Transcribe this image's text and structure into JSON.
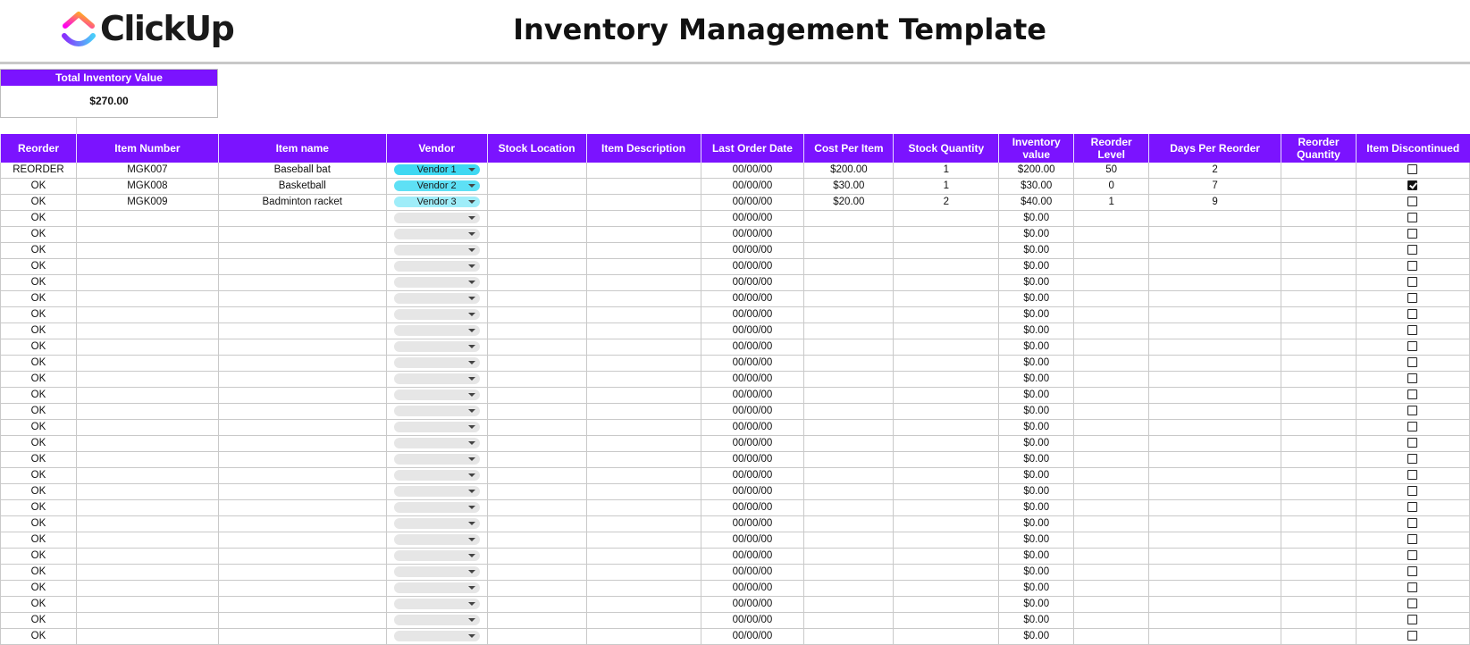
{
  "brand": {
    "name": "ClickUp",
    "logo_icon": "clickup-logo-icon"
  },
  "title": "Inventory Management Template",
  "summary": {
    "label": "Total Inventory Value",
    "value": "$270.00"
  },
  "columns": [
    "Reorder",
    "Item Number",
    "Item name",
    "Vendor",
    "Stock Location",
    "Item Description",
    "Last Order Date",
    "Cost Per Item",
    "Stock Quantity",
    "Inventory value",
    "Reorder Level",
    "Days Per Reorder",
    "Reorder Quantity",
    "Item Discontinued"
  ],
  "vendor_colors": {
    "Vendor 1": "#3fd8f2",
    "Vendor 2": "#5ee0f5",
    "Vendor 3": "#9fedf9"
  },
  "accent_color": "#7b13ff",
  "rows": [
    {
      "reorder": "REORDER",
      "item_number": "MGK007",
      "item_name": "Baseball bat",
      "vendor": "Vendor 1",
      "stock_location": "",
      "item_description": "",
      "last_order_date": "00/00/00",
      "cost_per_item": "$200.00",
      "stock_quantity": "1",
      "inventory_value": "$200.00",
      "reorder_level": "50",
      "days_per_reorder": "2",
      "reorder_quantity": "",
      "discontinued": false
    },
    {
      "reorder": "OK",
      "item_number": "MGK008",
      "item_name": "Basketball",
      "vendor": "Vendor 2",
      "stock_location": "",
      "item_description": "",
      "last_order_date": "00/00/00",
      "cost_per_item": "$30.00",
      "stock_quantity": "1",
      "inventory_value": "$30.00",
      "reorder_level": "0",
      "days_per_reorder": "7",
      "reorder_quantity": "",
      "discontinued": true
    },
    {
      "reorder": "OK",
      "item_number": "MGK009",
      "item_name": "Badminton racket",
      "vendor": "Vendor 3",
      "stock_location": "",
      "item_description": "",
      "last_order_date": "00/00/00",
      "cost_per_item": "$20.00",
      "stock_quantity": "2",
      "inventory_value": "$40.00",
      "reorder_level": "1",
      "days_per_reorder": "9",
      "reorder_quantity": "",
      "discontinued": false
    },
    {
      "reorder": "OK",
      "item_number": "",
      "item_name": "",
      "vendor": "",
      "stock_location": "",
      "item_description": "",
      "last_order_date": "00/00/00",
      "cost_per_item": "",
      "stock_quantity": "",
      "inventory_value": "$0.00",
      "reorder_level": "",
      "days_per_reorder": "",
      "reorder_quantity": "",
      "discontinued": false
    },
    {
      "reorder": "OK",
      "item_number": "",
      "item_name": "",
      "vendor": "",
      "stock_location": "",
      "item_description": "",
      "last_order_date": "00/00/00",
      "cost_per_item": "",
      "stock_quantity": "",
      "inventory_value": "$0.00",
      "reorder_level": "",
      "days_per_reorder": "",
      "reorder_quantity": "",
      "discontinued": false
    },
    {
      "reorder": "OK",
      "item_number": "",
      "item_name": "",
      "vendor": "",
      "stock_location": "",
      "item_description": "",
      "last_order_date": "00/00/00",
      "cost_per_item": "",
      "stock_quantity": "",
      "inventory_value": "$0.00",
      "reorder_level": "",
      "days_per_reorder": "",
      "reorder_quantity": "",
      "discontinued": false
    },
    {
      "reorder": "OK",
      "item_number": "",
      "item_name": "",
      "vendor": "",
      "stock_location": "",
      "item_description": "",
      "last_order_date": "00/00/00",
      "cost_per_item": "",
      "stock_quantity": "",
      "inventory_value": "$0.00",
      "reorder_level": "",
      "days_per_reorder": "",
      "reorder_quantity": "",
      "discontinued": false
    },
    {
      "reorder": "OK",
      "item_number": "",
      "item_name": "",
      "vendor": "",
      "stock_location": "",
      "item_description": "",
      "last_order_date": "00/00/00",
      "cost_per_item": "",
      "stock_quantity": "",
      "inventory_value": "$0.00",
      "reorder_level": "",
      "days_per_reorder": "",
      "reorder_quantity": "",
      "discontinued": false
    },
    {
      "reorder": "OK",
      "item_number": "",
      "item_name": "",
      "vendor": "",
      "stock_location": "",
      "item_description": "",
      "last_order_date": "00/00/00",
      "cost_per_item": "",
      "stock_quantity": "",
      "inventory_value": "$0.00",
      "reorder_level": "",
      "days_per_reorder": "",
      "reorder_quantity": "",
      "discontinued": false
    },
    {
      "reorder": "OK",
      "item_number": "",
      "item_name": "",
      "vendor": "",
      "stock_location": "",
      "item_description": "",
      "last_order_date": "00/00/00",
      "cost_per_item": "",
      "stock_quantity": "",
      "inventory_value": "$0.00",
      "reorder_level": "",
      "days_per_reorder": "",
      "reorder_quantity": "",
      "discontinued": false
    },
    {
      "reorder": "OK",
      "item_number": "",
      "item_name": "",
      "vendor": "",
      "stock_location": "",
      "item_description": "",
      "last_order_date": "00/00/00",
      "cost_per_item": "",
      "stock_quantity": "",
      "inventory_value": "$0.00",
      "reorder_level": "",
      "days_per_reorder": "",
      "reorder_quantity": "",
      "discontinued": false
    },
    {
      "reorder": "OK",
      "item_number": "",
      "item_name": "",
      "vendor": "",
      "stock_location": "",
      "item_description": "",
      "last_order_date": "00/00/00",
      "cost_per_item": "",
      "stock_quantity": "",
      "inventory_value": "$0.00",
      "reorder_level": "",
      "days_per_reorder": "",
      "reorder_quantity": "",
      "discontinued": false
    },
    {
      "reorder": "OK",
      "item_number": "",
      "item_name": "",
      "vendor": "",
      "stock_location": "",
      "item_description": "",
      "last_order_date": "00/00/00",
      "cost_per_item": "",
      "stock_quantity": "",
      "inventory_value": "$0.00",
      "reorder_level": "",
      "days_per_reorder": "",
      "reorder_quantity": "",
      "discontinued": false
    },
    {
      "reorder": "OK",
      "item_number": "",
      "item_name": "",
      "vendor": "",
      "stock_location": "",
      "item_description": "",
      "last_order_date": "00/00/00",
      "cost_per_item": "",
      "stock_quantity": "",
      "inventory_value": "$0.00",
      "reorder_level": "",
      "days_per_reorder": "",
      "reorder_quantity": "",
      "discontinued": false
    },
    {
      "reorder": "OK",
      "item_number": "",
      "item_name": "",
      "vendor": "",
      "stock_location": "",
      "item_description": "",
      "last_order_date": "00/00/00",
      "cost_per_item": "",
      "stock_quantity": "",
      "inventory_value": "$0.00",
      "reorder_level": "",
      "days_per_reorder": "",
      "reorder_quantity": "",
      "discontinued": false
    },
    {
      "reorder": "OK",
      "item_number": "",
      "item_name": "",
      "vendor": "",
      "stock_location": "",
      "item_description": "",
      "last_order_date": "00/00/00",
      "cost_per_item": "",
      "stock_quantity": "",
      "inventory_value": "$0.00",
      "reorder_level": "",
      "days_per_reorder": "",
      "reorder_quantity": "",
      "discontinued": false
    },
    {
      "reorder": "OK",
      "item_number": "",
      "item_name": "",
      "vendor": "",
      "stock_location": "",
      "item_description": "",
      "last_order_date": "00/00/00",
      "cost_per_item": "",
      "stock_quantity": "",
      "inventory_value": "$0.00",
      "reorder_level": "",
      "days_per_reorder": "",
      "reorder_quantity": "",
      "discontinued": false
    },
    {
      "reorder": "OK",
      "item_number": "",
      "item_name": "",
      "vendor": "",
      "stock_location": "",
      "item_description": "",
      "last_order_date": "00/00/00",
      "cost_per_item": "",
      "stock_quantity": "",
      "inventory_value": "$0.00",
      "reorder_level": "",
      "days_per_reorder": "",
      "reorder_quantity": "",
      "discontinued": false
    },
    {
      "reorder": "OK",
      "item_number": "",
      "item_name": "",
      "vendor": "",
      "stock_location": "",
      "item_description": "",
      "last_order_date": "00/00/00",
      "cost_per_item": "",
      "stock_quantity": "",
      "inventory_value": "$0.00",
      "reorder_level": "",
      "days_per_reorder": "",
      "reorder_quantity": "",
      "discontinued": false
    },
    {
      "reorder": "OK",
      "item_number": "",
      "item_name": "",
      "vendor": "",
      "stock_location": "",
      "item_description": "",
      "last_order_date": "00/00/00",
      "cost_per_item": "",
      "stock_quantity": "",
      "inventory_value": "$0.00",
      "reorder_level": "",
      "days_per_reorder": "",
      "reorder_quantity": "",
      "discontinued": false
    },
    {
      "reorder": "OK",
      "item_number": "",
      "item_name": "",
      "vendor": "",
      "stock_location": "",
      "item_description": "",
      "last_order_date": "00/00/00",
      "cost_per_item": "",
      "stock_quantity": "",
      "inventory_value": "$0.00",
      "reorder_level": "",
      "days_per_reorder": "",
      "reorder_quantity": "",
      "discontinued": false
    },
    {
      "reorder": "OK",
      "item_number": "",
      "item_name": "",
      "vendor": "",
      "stock_location": "",
      "item_description": "",
      "last_order_date": "00/00/00",
      "cost_per_item": "",
      "stock_quantity": "",
      "inventory_value": "$0.00",
      "reorder_level": "",
      "days_per_reorder": "",
      "reorder_quantity": "",
      "discontinued": false
    },
    {
      "reorder": "OK",
      "item_number": "",
      "item_name": "",
      "vendor": "",
      "stock_location": "",
      "item_description": "",
      "last_order_date": "00/00/00",
      "cost_per_item": "",
      "stock_quantity": "",
      "inventory_value": "$0.00",
      "reorder_level": "",
      "days_per_reorder": "",
      "reorder_quantity": "",
      "discontinued": false
    },
    {
      "reorder": "OK",
      "item_number": "",
      "item_name": "",
      "vendor": "",
      "stock_location": "",
      "item_description": "",
      "last_order_date": "00/00/00",
      "cost_per_item": "",
      "stock_quantity": "",
      "inventory_value": "$0.00",
      "reorder_level": "",
      "days_per_reorder": "",
      "reorder_quantity": "",
      "discontinued": false
    },
    {
      "reorder": "OK",
      "item_number": "",
      "item_name": "",
      "vendor": "",
      "stock_location": "",
      "item_description": "",
      "last_order_date": "00/00/00",
      "cost_per_item": "",
      "stock_quantity": "",
      "inventory_value": "$0.00",
      "reorder_level": "",
      "days_per_reorder": "",
      "reorder_quantity": "",
      "discontinued": false
    },
    {
      "reorder": "OK",
      "item_number": "",
      "item_name": "",
      "vendor": "",
      "stock_location": "",
      "item_description": "",
      "last_order_date": "00/00/00",
      "cost_per_item": "",
      "stock_quantity": "",
      "inventory_value": "$0.00",
      "reorder_level": "",
      "days_per_reorder": "",
      "reorder_quantity": "",
      "discontinued": false
    },
    {
      "reorder": "OK",
      "item_number": "",
      "item_name": "",
      "vendor": "",
      "stock_location": "",
      "item_description": "",
      "last_order_date": "00/00/00",
      "cost_per_item": "",
      "stock_quantity": "",
      "inventory_value": "$0.00",
      "reorder_level": "",
      "days_per_reorder": "",
      "reorder_quantity": "",
      "discontinued": false
    },
    {
      "reorder": "OK",
      "item_number": "",
      "item_name": "",
      "vendor": "",
      "stock_location": "",
      "item_description": "",
      "last_order_date": "00/00/00",
      "cost_per_item": "",
      "stock_quantity": "",
      "inventory_value": "$0.00",
      "reorder_level": "",
      "days_per_reorder": "",
      "reorder_quantity": "",
      "discontinued": false
    },
    {
      "reorder": "OK",
      "item_number": "",
      "item_name": "",
      "vendor": "",
      "stock_location": "",
      "item_description": "",
      "last_order_date": "00/00/00",
      "cost_per_item": "",
      "stock_quantity": "",
      "inventory_value": "$0.00",
      "reorder_level": "",
      "days_per_reorder": "",
      "reorder_quantity": "",
      "discontinued": false
    },
    {
      "reorder": "OK",
      "item_number": "",
      "item_name": "",
      "vendor": "",
      "stock_location": "",
      "item_description": "",
      "last_order_date": "00/00/00",
      "cost_per_item": "",
      "stock_quantity": "",
      "inventory_value": "$0.00",
      "reorder_level": "",
      "days_per_reorder": "",
      "reorder_quantity": "",
      "discontinued": false
    }
  ]
}
